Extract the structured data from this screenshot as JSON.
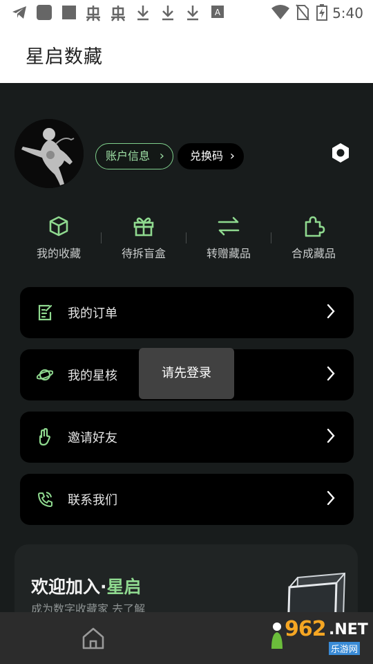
{
  "status_bar": {
    "time": "5:40",
    "icons": [
      "telegram-icon",
      "app-icon",
      "app-icon",
      "bug-icon",
      "bug-icon",
      "download-icon",
      "download-icon",
      "download-icon",
      "font-icon",
      "wifi-icon",
      "no-sim-icon",
      "battery-charging-icon"
    ]
  },
  "header": {
    "title": "星启数藏"
  },
  "profile": {
    "account_info": "账户信息",
    "redeem_code": "兑换码"
  },
  "quick_actions": [
    {
      "label": "我的收藏",
      "icon": "box-icon"
    },
    {
      "label": "待拆盲盒",
      "icon": "gift-icon"
    },
    {
      "label": "转赠藏品",
      "icon": "transfer-icon"
    },
    {
      "label": "合成藏品",
      "icon": "puzzle-icon"
    }
  ],
  "menu": [
    {
      "label": "我的订单",
      "icon": "order-icon"
    },
    {
      "label": "我的星核",
      "icon": "planet-icon"
    },
    {
      "label": "邀请好友",
      "icon": "hand-icon"
    },
    {
      "label": "联系我们",
      "icon": "phone-icon"
    }
  ],
  "toast": {
    "text": "请先登录"
  },
  "promo": {
    "title_prefix": "欢迎加入·",
    "title_accent": "星启",
    "subtitle": "成为数字收藏家 去了解"
  },
  "bottom_nav": {
    "home_icon": "home-icon"
  },
  "watermark": {
    "number": "962",
    "suffix": ".NET",
    "site": "乐游网"
  },
  "colors": {
    "accent": "#8fd98f",
    "background": "#181c1c",
    "card": "#000000"
  }
}
